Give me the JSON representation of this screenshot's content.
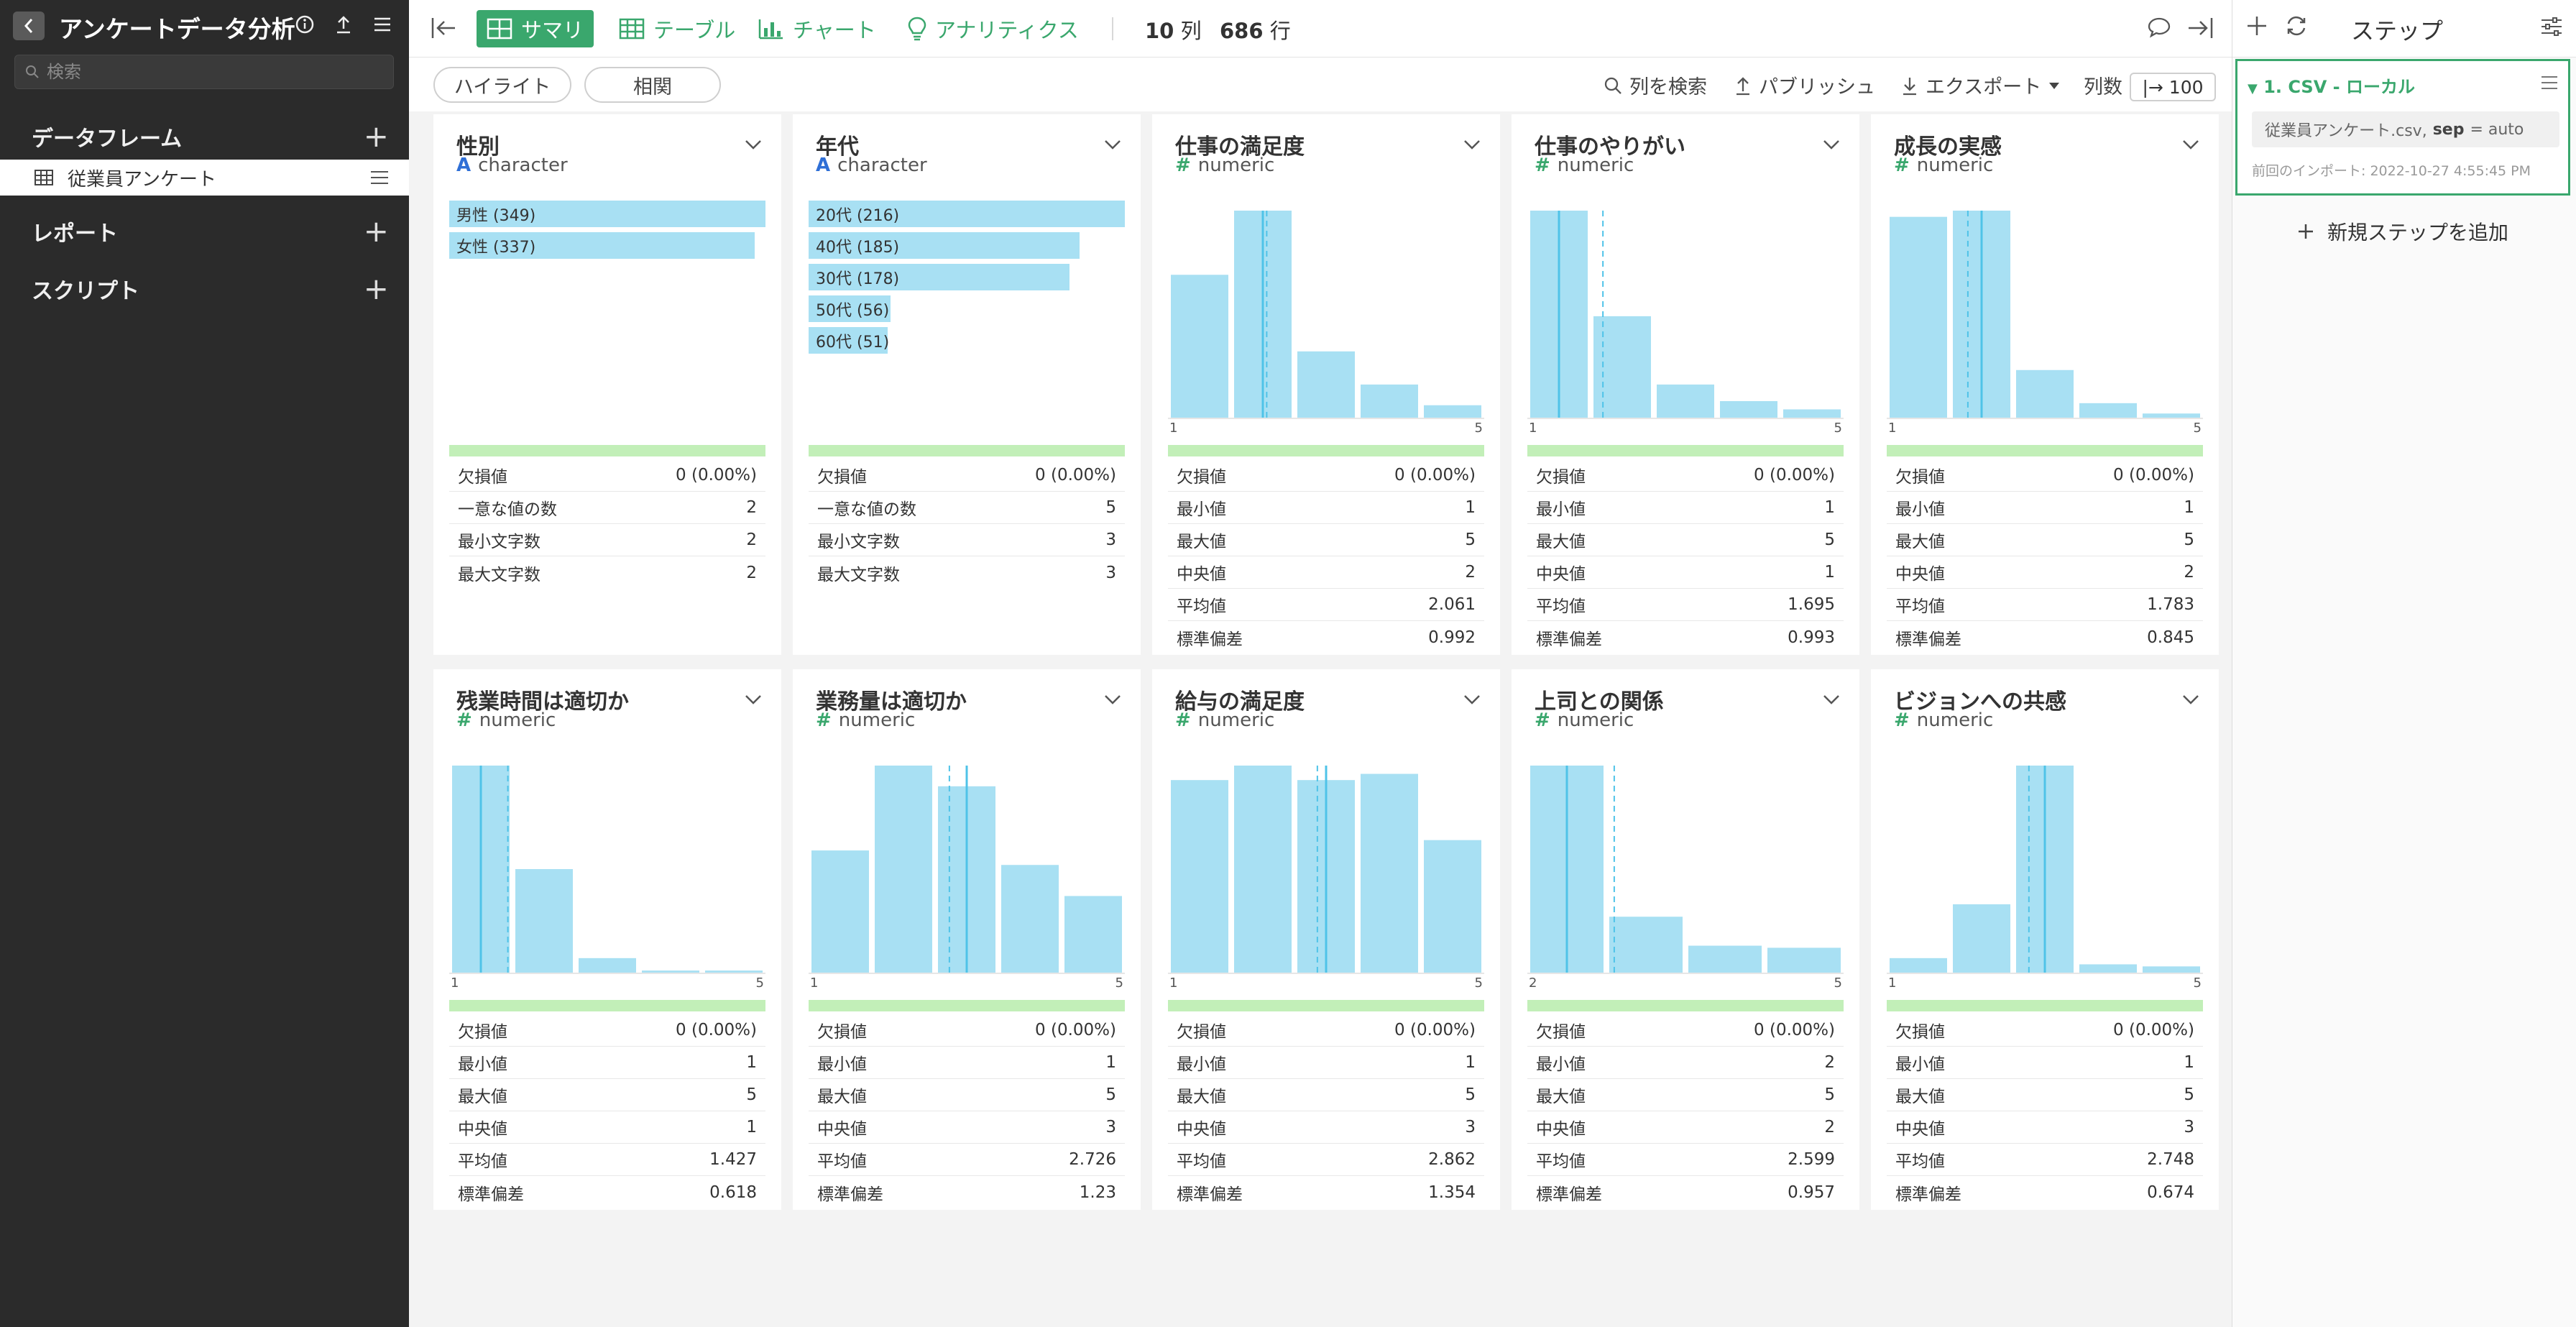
{
  "sidebar": {
    "title": "アンケートデータ分析",
    "search_placeholder": "検索",
    "sections": {
      "dataframes": "データフレーム",
      "reports": "レポート",
      "scripts": "スクリプト"
    },
    "dataframe_item": "従業員アンケート"
  },
  "toolbar": {
    "tabs": [
      "サマリ",
      "テーブル",
      "チャート",
      "アナリティクス"
    ],
    "columns_count": "10",
    "columns_unit": "列",
    "rows_count": "686",
    "rows_unit": "行"
  },
  "actions": {
    "highlight": "ハイライト",
    "correlation": "相関",
    "search_columns": "列を検索",
    "publish": "パブリッシュ",
    "export": "エクスポート",
    "column_count_label": "列数",
    "column_count_value": "|→ 100"
  },
  "colors": {
    "accent": "#3aa76d",
    "bar": "#a8e0f3",
    "median_line": "#4fc3e8",
    "quality_bar": "#c2efb8"
  },
  "cards": [
    {
      "name": "性別",
      "type": "character",
      "categories": [
        {
          "label": "男性 (349)",
          "count": 349
        },
        {
          "label": "女性 (337)",
          "count": 337
        }
      ],
      "stats": [
        {
          "label": "欠損値",
          "value": "0 (0.00%)"
        },
        {
          "label": "一意な値の数",
          "value": "2"
        },
        {
          "label": "最小文字数",
          "value": "2"
        },
        {
          "label": "最大文字数",
          "value": "2"
        }
      ]
    },
    {
      "name": "年代",
      "type": "character",
      "categories": [
        {
          "label": "20代 (216)",
          "count": 216
        },
        {
          "label": "40代 (185)",
          "count": 185
        },
        {
          "label": "30代 (178)",
          "count": 178
        },
        {
          "label": "50代 (56)",
          "count": 56
        },
        {
          "label": "60代 (51)",
          "count": 51
        }
      ],
      "stats": [
        {
          "label": "欠損値",
          "value": "0 (0.00%)"
        },
        {
          "label": "一意な値の数",
          "value": "5"
        },
        {
          "label": "最小文字数",
          "value": "3"
        },
        {
          "label": "最大文字数",
          "value": "3"
        }
      ]
    },
    {
      "name": "仕事の満足度",
      "type": "numeric",
      "histogram": {
        "min_label": "1",
        "max_label": "5",
        "bins": [
          0.69,
          1.0,
          0.32,
          0.16,
          0.06
        ],
        "median": 2,
        "mean": 2.061
      },
      "stats": [
        {
          "label": "欠損値",
          "value": "0 (0.00%)"
        },
        {
          "label": "最小値",
          "value": "1"
        },
        {
          "label": "最大値",
          "value": "5"
        },
        {
          "label": "中央値",
          "value": "2"
        },
        {
          "label": "平均値",
          "value": "2.061"
        },
        {
          "label": "標準偏差",
          "value": "0.992"
        }
      ]
    },
    {
      "name": "仕事のやりがい",
      "type": "numeric",
      "histogram": {
        "min_label": "1",
        "max_label": "5",
        "bins": [
          1.0,
          0.49,
          0.16,
          0.08,
          0.04
        ],
        "median": 1,
        "mean": 1.695
      },
      "stats": [
        {
          "label": "欠損値",
          "value": "0 (0.00%)"
        },
        {
          "label": "最小値",
          "value": "1"
        },
        {
          "label": "最大値",
          "value": "5"
        },
        {
          "label": "中央値",
          "value": "1"
        },
        {
          "label": "平均値",
          "value": "1.695"
        },
        {
          "label": "標準偏差",
          "value": "0.993"
        }
      ]
    },
    {
      "name": "成長の実感",
      "type": "numeric",
      "histogram": {
        "min_label": "1",
        "max_label": "5",
        "bins": [
          0.97,
          1.0,
          0.23,
          0.07,
          0.02
        ],
        "median": 2,
        "mean": 1.783
      },
      "stats": [
        {
          "label": "欠損値",
          "value": "0 (0.00%)"
        },
        {
          "label": "最小値",
          "value": "1"
        },
        {
          "label": "最大値",
          "value": "5"
        },
        {
          "label": "中央値",
          "value": "2"
        },
        {
          "label": "平均値",
          "value": "1.783"
        },
        {
          "label": "標準偏差",
          "value": "0.845"
        }
      ]
    },
    {
      "name": "残業時間は適切か",
      "type": "numeric",
      "histogram": {
        "min_label": "1",
        "max_label": "5",
        "bins": [
          1.0,
          0.5,
          0.07,
          0.01,
          0.01
        ],
        "median": 1,
        "mean": 1.427
      },
      "stats": [
        {
          "label": "欠損値",
          "value": "0 (0.00%)"
        },
        {
          "label": "最小値",
          "value": "1"
        },
        {
          "label": "最大値",
          "value": "5"
        },
        {
          "label": "中央値",
          "value": "1"
        },
        {
          "label": "平均値",
          "value": "1.427"
        },
        {
          "label": "標準偏差",
          "value": "0.618"
        }
      ]
    },
    {
      "name": "業務量は適切か",
      "type": "numeric",
      "histogram": {
        "min_label": "1",
        "max_label": "5",
        "bins": [
          0.59,
          1.0,
          0.9,
          0.52,
          0.37
        ],
        "median": 3,
        "mean": 2.726
      },
      "stats": [
        {
          "label": "欠損値",
          "value": "0 (0.00%)"
        },
        {
          "label": "最小値",
          "value": "1"
        },
        {
          "label": "最大値",
          "value": "5"
        },
        {
          "label": "中央値",
          "value": "3"
        },
        {
          "label": "平均値",
          "value": "2.726"
        },
        {
          "label": "標準偏差",
          "value": "1.23"
        }
      ]
    },
    {
      "name": "給与の満足度",
      "type": "numeric",
      "histogram": {
        "min_label": "1",
        "max_label": "5",
        "bins": [
          0.93,
          1.0,
          0.93,
          0.96,
          0.64
        ],
        "median": 3,
        "mean": 2.862
      },
      "stats": [
        {
          "label": "欠損値",
          "value": "0 (0.00%)"
        },
        {
          "label": "最小値",
          "value": "1"
        },
        {
          "label": "最大値",
          "value": "5"
        },
        {
          "label": "中央値",
          "value": "3"
        },
        {
          "label": "平均値",
          "value": "2.862"
        },
        {
          "label": "標準偏差",
          "value": "1.354"
        }
      ]
    },
    {
      "name": "上司との関係",
      "type": "numeric",
      "histogram": {
        "min_label": "2",
        "max_label": "5",
        "bins": [
          1.0,
          0.27,
          0.13,
          0.12
        ],
        "median": 2,
        "mean": 2.599
      },
      "stats": [
        {
          "label": "欠損値",
          "value": "0 (0.00%)"
        },
        {
          "label": "最小値",
          "value": "2"
        },
        {
          "label": "最大値",
          "value": "5"
        },
        {
          "label": "中央値",
          "value": "2"
        },
        {
          "label": "平均値",
          "value": "2.599"
        },
        {
          "label": "標準偏差",
          "value": "0.957"
        }
      ]
    },
    {
      "name": "ビジョンへの共感",
      "type": "numeric",
      "histogram": {
        "min_label": "1",
        "max_label": "5",
        "bins": [
          0.07,
          0.33,
          1.0,
          0.04,
          0.03
        ],
        "median": 3,
        "mean": 2.748
      },
      "stats": [
        {
          "label": "欠損値",
          "value": "0 (0.00%)"
        },
        {
          "label": "最小値",
          "value": "1"
        },
        {
          "label": "最大値",
          "value": "5"
        },
        {
          "label": "中央値",
          "value": "3"
        },
        {
          "label": "平均値",
          "value": "2.748"
        },
        {
          "label": "標準偏差",
          "value": "0.674"
        }
      ]
    }
  ],
  "steps": {
    "title": "ステップ",
    "step_name": "1. CSV - ローカル",
    "detail_file": "従業員アンケート.csv,",
    "detail_key": "sep",
    "detail_value": "= auto",
    "last_import": "前回のインポート: 2022-10-27 4:55:45 PM",
    "add_step": "新規ステップを追加"
  }
}
